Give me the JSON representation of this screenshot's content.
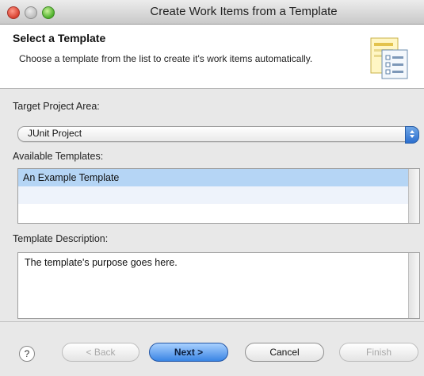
{
  "window": {
    "title": "Create Work Items from a Template"
  },
  "header": {
    "title": "Select a Template",
    "description": "Choose a template from the list to create it's work items automatically."
  },
  "project": {
    "label": "Target Project Area:",
    "selected": "JUnit Project"
  },
  "templates": {
    "label": "Available Templates:",
    "items": [
      "An Example Template"
    ]
  },
  "description": {
    "label": "Template Description:",
    "text": "The template's purpose goes here."
  },
  "footer": {
    "help": "?",
    "back": "< Back",
    "next": "Next >",
    "cancel": "Cancel",
    "finish": "Finish"
  }
}
